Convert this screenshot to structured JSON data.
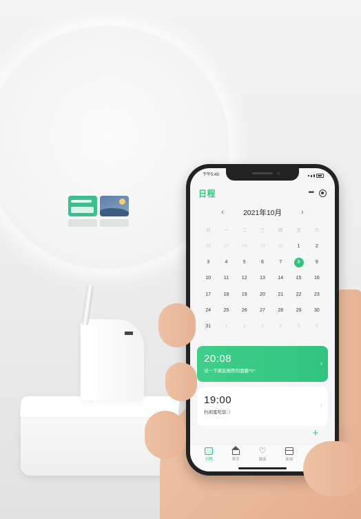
{
  "status_bar": {
    "time": "下午5:49"
  },
  "app": {
    "title": "日程"
  },
  "calendar": {
    "month_label": "2021年10月",
    "weekdays": [
      "日",
      "一",
      "二",
      "三",
      "四",
      "五",
      "六"
    ],
    "weeks": [
      [
        {
          "d": "26",
          "muted": true
        },
        {
          "d": "27",
          "muted": true
        },
        {
          "d": "28",
          "muted": true
        },
        {
          "d": "29",
          "muted": true
        },
        {
          "d": "30",
          "muted": true
        },
        {
          "d": "1"
        },
        {
          "d": "2"
        }
      ],
      [
        {
          "d": "3"
        },
        {
          "d": "4"
        },
        {
          "d": "5"
        },
        {
          "d": "6"
        },
        {
          "d": "7"
        },
        {
          "d": "8",
          "today": true
        },
        {
          "d": "9"
        }
      ],
      [
        {
          "d": "10"
        },
        {
          "d": "11"
        },
        {
          "d": "12"
        },
        {
          "d": "13"
        },
        {
          "d": "14"
        },
        {
          "d": "15"
        },
        {
          "d": "16"
        }
      ],
      [
        {
          "d": "17"
        },
        {
          "d": "18"
        },
        {
          "d": "19"
        },
        {
          "d": "20"
        },
        {
          "d": "21"
        },
        {
          "d": "22"
        },
        {
          "d": "23"
        }
      ],
      [
        {
          "d": "24"
        },
        {
          "d": "25"
        },
        {
          "d": "26"
        },
        {
          "d": "27"
        },
        {
          "d": "28"
        },
        {
          "d": "29"
        },
        {
          "d": "30"
        }
      ],
      [
        {
          "d": "31"
        },
        {
          "d": "1",
          "muted": true
        },
        {
          "d": "2",
          "muted": true
        },
        {
          "d": "3",
          "muted": true
        },
        {
          "d": "4",
          "muted": true
        },
        {
          "d": "5",
          "muted": true
        },
        {
          "d": "6",
          "muted": true
        }
      ]
    ]
  },
  "events": [
    {
      "time": "20:08",
      "desc": "试一下朋友推荐的面膜^0^"
    },
    {
      "time": "19:00",
      "desc": "约闺蜜吃饭：）"
    }
  ],
  "fab": {
    "icon": "plus-icon",
    "symbol": "+"
  },
  "tabbar": {
    "tabs": [
      {
        "label": "日程",
        "icon": "calendar-icon",
        "active": true
      },
      {
        "label": "首页",
        "icon": "home-icon"
      },
      {
        "label": "健康",
        "icon": "heart-icon"
      },
      {
        "label": "商城",
        "icon": "box-icon"
      },
      {
        "label": "我的",
        "icon": "user-icon"
      }
    ]
  },
  "colors": {
    "accent": "#2fc480",
    "muted": "#d4d4d4"
  }
}
